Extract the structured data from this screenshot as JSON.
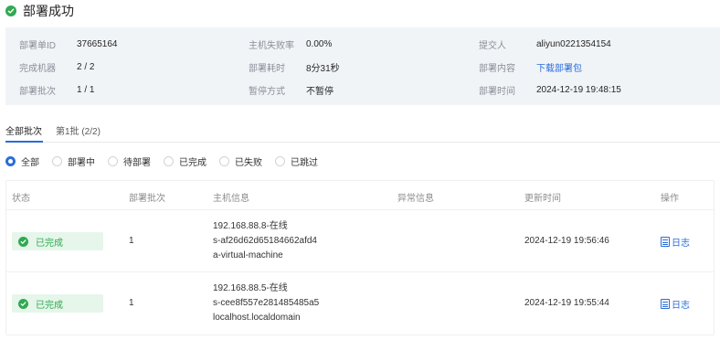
{
  "header": {
    "title": "部署成功"
  },
  "summary": {
    "col1": [
      {
        "label": "部署单ID",
        "value": "37665164"
      },
      {
        "label": "完成机器",
        "value": "2 / 2"
      },
      {
        "label": "部署批次",
        "value": "1 / 1"
      }
    ],
    "col2": [
      {
        "label": "主机失败率",
        "value": "0.00%"
      },
      {
        "label": "部署耗时",
        "value": "8分31秒"
      },
      {
        "label": "暂停方式",
        "value": "不暂停"
      }
    ],
    "col3": [
      {
        "label": "提交人",
        "value": "aliyun0221354154"
      },
      {
        "label": "部署内容",
        "value": "下载部署包"
      },
      {
        "label": "部署时间",
        "value": "2024-12-19 19:48:15"
      }
    ]
  },
  "tabs": [
    {
      "label": "全部批次"
    },
    {
      "label": "第1批 (2/2)"
    }
  ],
  "filters": [
    {
      "label": "全部"
    },
    {
      "label": "部署中"
    },
    {
      "label": "待部署"
    },
    {
      "label": "已完成"
    },
    {
      "label": "已失败"
    },
    {
      "label": "已跳过"
    }
  ],
  "selected_filter": "全部",
  "table": {
    "headers": [
      "状态",
      "部署批次",
      "主机信息",
      "异常信息",
      "更新时间",
      "操作"
    ],
    "rows": [
      {
        "status": "已完成",
        "batch": "1",
        "host_ip": "192.168.88.8-在线",
        "host_id": "s-af26d62d65184662afd4",
        "host_name": "a-virtual-machine",
        "error": "",
        "updated": "2024-12-19 19:56:46",
        "action": "日志"
      },
      {
        "status": "已完成",
        "batch": "1",
        "host_ip": "192.168.88.5-在线",
        "host_id": "s-cee8f557e281485485a5",
        "host_name": "localhost.localdomain",
        "error": "",
        "updated": "2024-12-19 19:55:44",
        "action": "日志"
      }
    ]
  },
  "colors": {
    "accent": "#2a6ddb",
    "success": "#2faa52",
    "success_bg": "#e6f6ea",
    "summary_bg": "#f1f4f7"
  },
  "icons": {
    "header_status": "check-circle-icon",
    "row_status": "check-circle-icon",
    "log": "document-icon"
  }
}
